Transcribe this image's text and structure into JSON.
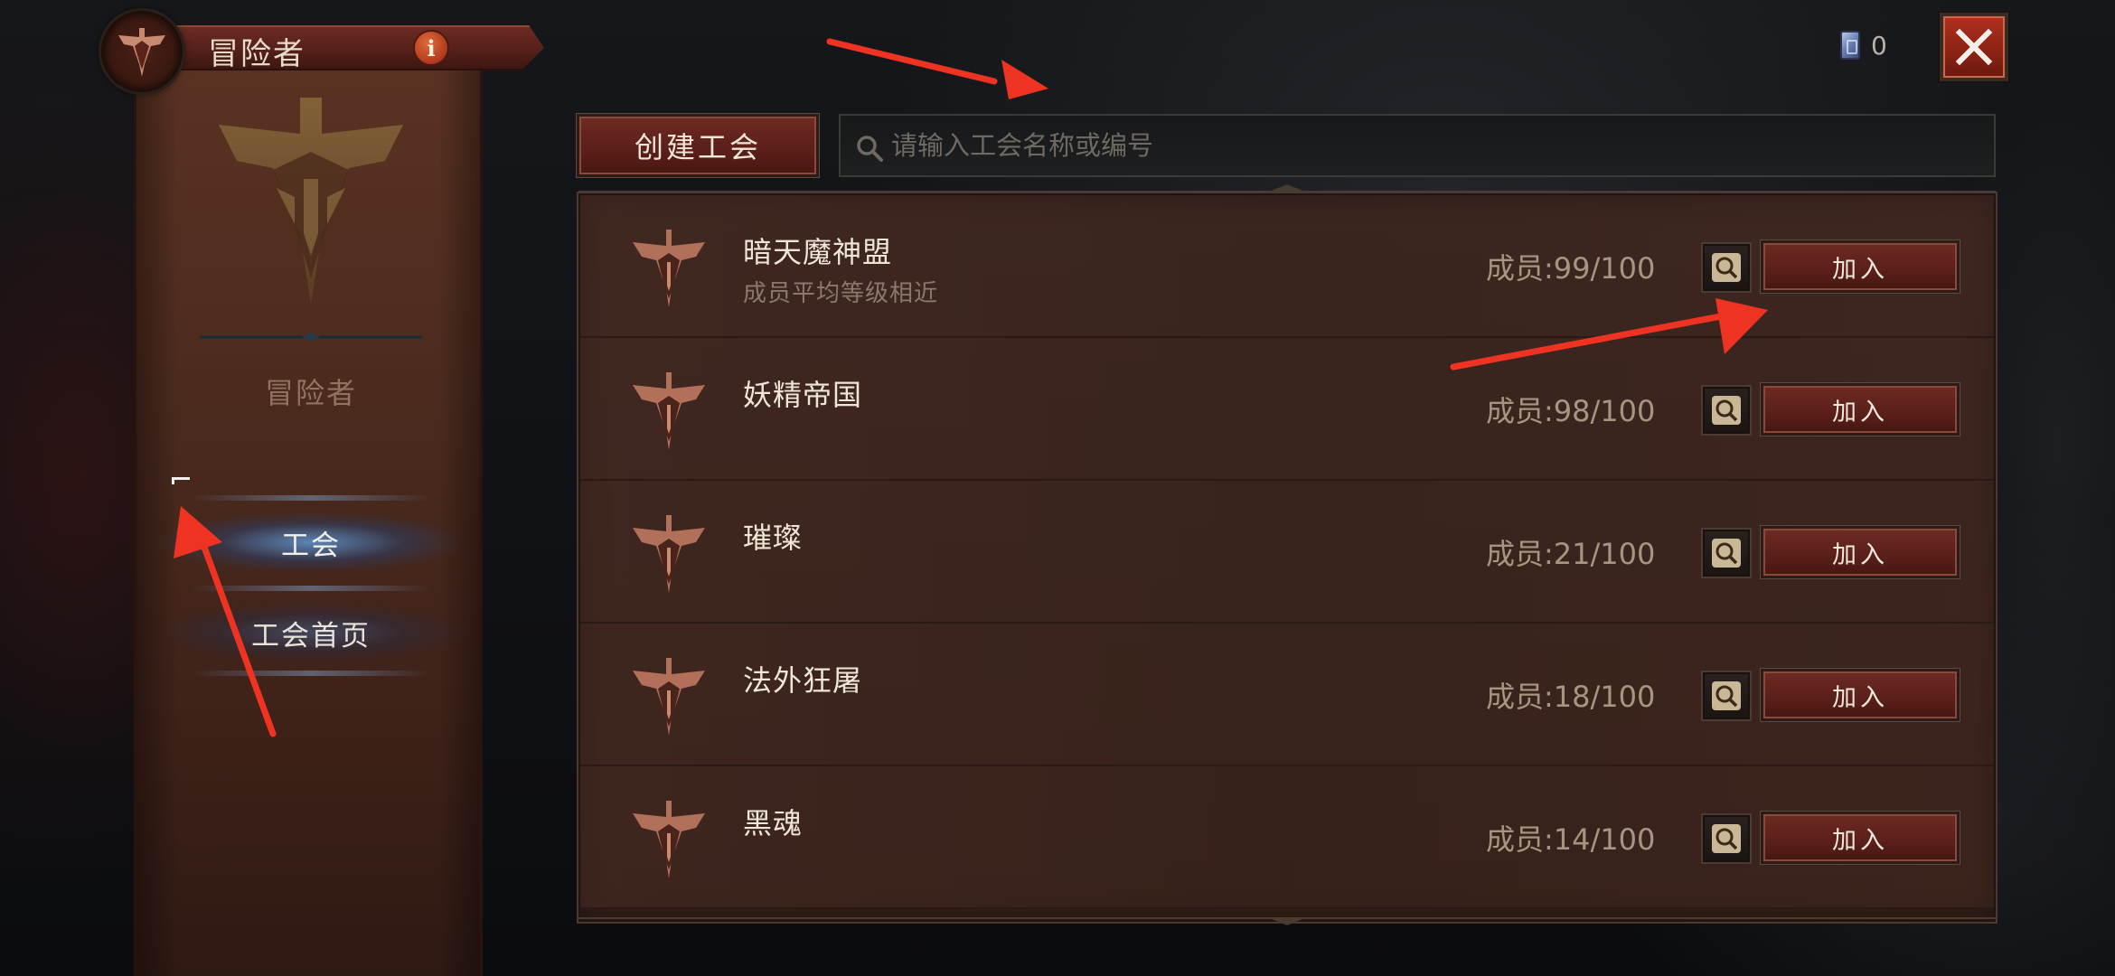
{
  "header": {
    "title": "冒险者",
    "info_label": "i"
  },
  "sidebar": {
    "title": "冒险者",
    "items": [
      {
        "label": "工会",
        "active": true
      },
      {
        "label": "工会首页",
        "active": false
      }
    ]
  },
  "currency": {
    "icon": "card-icon",
    "value": "0"
  },
  "toolbar": {
    "create_label": "创建工会",
    "search_placeholder": "请输入工会名称或编号",
    "search_value": ""
  },
  "guilds": [
    {
      "name": "暗天魔神盟",
      "desc": "成员平均等级相近",
      "members": "成员:99/100",
      "join_label": "加入"
    },
    {
      "name": "妖精帝国",
      "desc": "",
      "members": "成员:98/100",
      "join_label": "加入"
    },
    {
      "name": "璀璨",
      "desc": "",
      "members": "成员:21/100",
      "join_label": "加入"
    },
    {
      "name": "法外狂屠",
      "desc": "",
      "members": "成员:18/100",
      "join_label": "加入"
    },
    {
      "name": "黑魂",
      "desc": "",
      "members": "成员:14/100",
      "join_label": "加入"
    }
  ],
  "colors": {
    "accent_red": "#5a1f19",
    "annotation_arrow": "#ee3322",
    "nav_active_glow": "#6096d2"
  }
}
